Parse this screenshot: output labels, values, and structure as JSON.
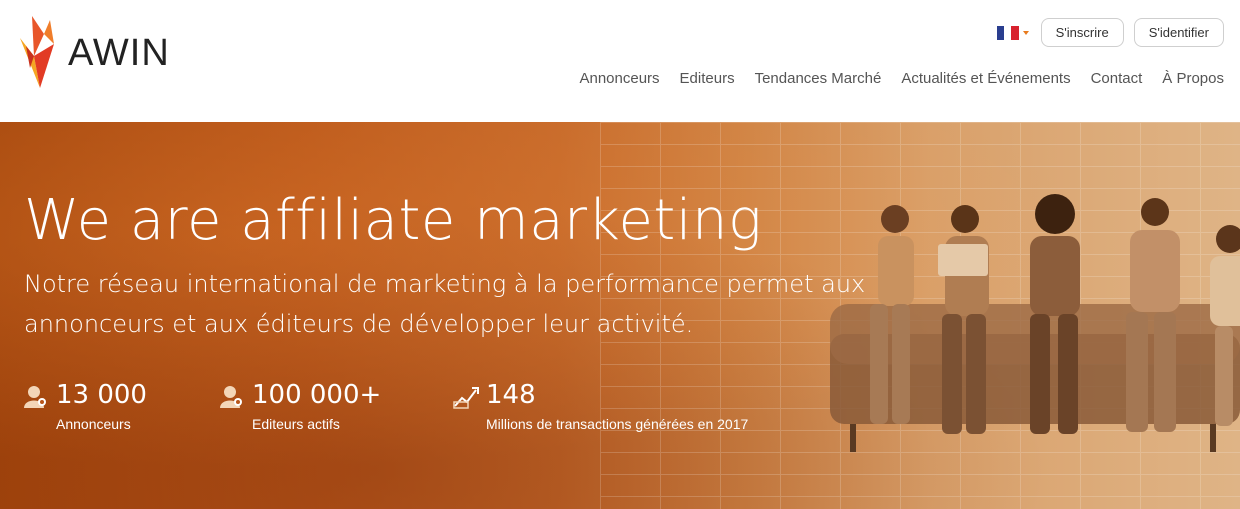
{
  "brand": {
    "name": "AWIN",
    "accent": "#e8562a"
  },
  "header": {
    "language_flag": "fr-flag-icon",
    "register_label": "S'inscrire",
    "login_label": "S'identifier",
    "nav": [
      "Annonceurs",
      "Editeurs",
      "Tendances Marché",
      "Actualités et Événements",
      "Contact",
      "À Propos"
    ]
  },
  "hero": {
    "title": "We are affiliate marketing",
    "subtitle": "Notre réseau international de marketing à la performance permet aux annonceurs et aux éditeurs de développer leur activité.",
    "stats": [
      {
        "icon": "person-icon",
        "value": "13 000",
        "label": "Annonceurs"
      },
      {
        "icon": "person-icon",
        "value": "100 000+",
        "label": "Editeurs actifs"
      },
      {
        "icon": "growth-chart-icon",
        "value": "148",
        "label": "Millions de transactions générées en 2017"
      }
    ]
  },
  "colors": {
    "hero_dark": "#a4460d",
    "hero_light": "#dfb486"
  }
}
